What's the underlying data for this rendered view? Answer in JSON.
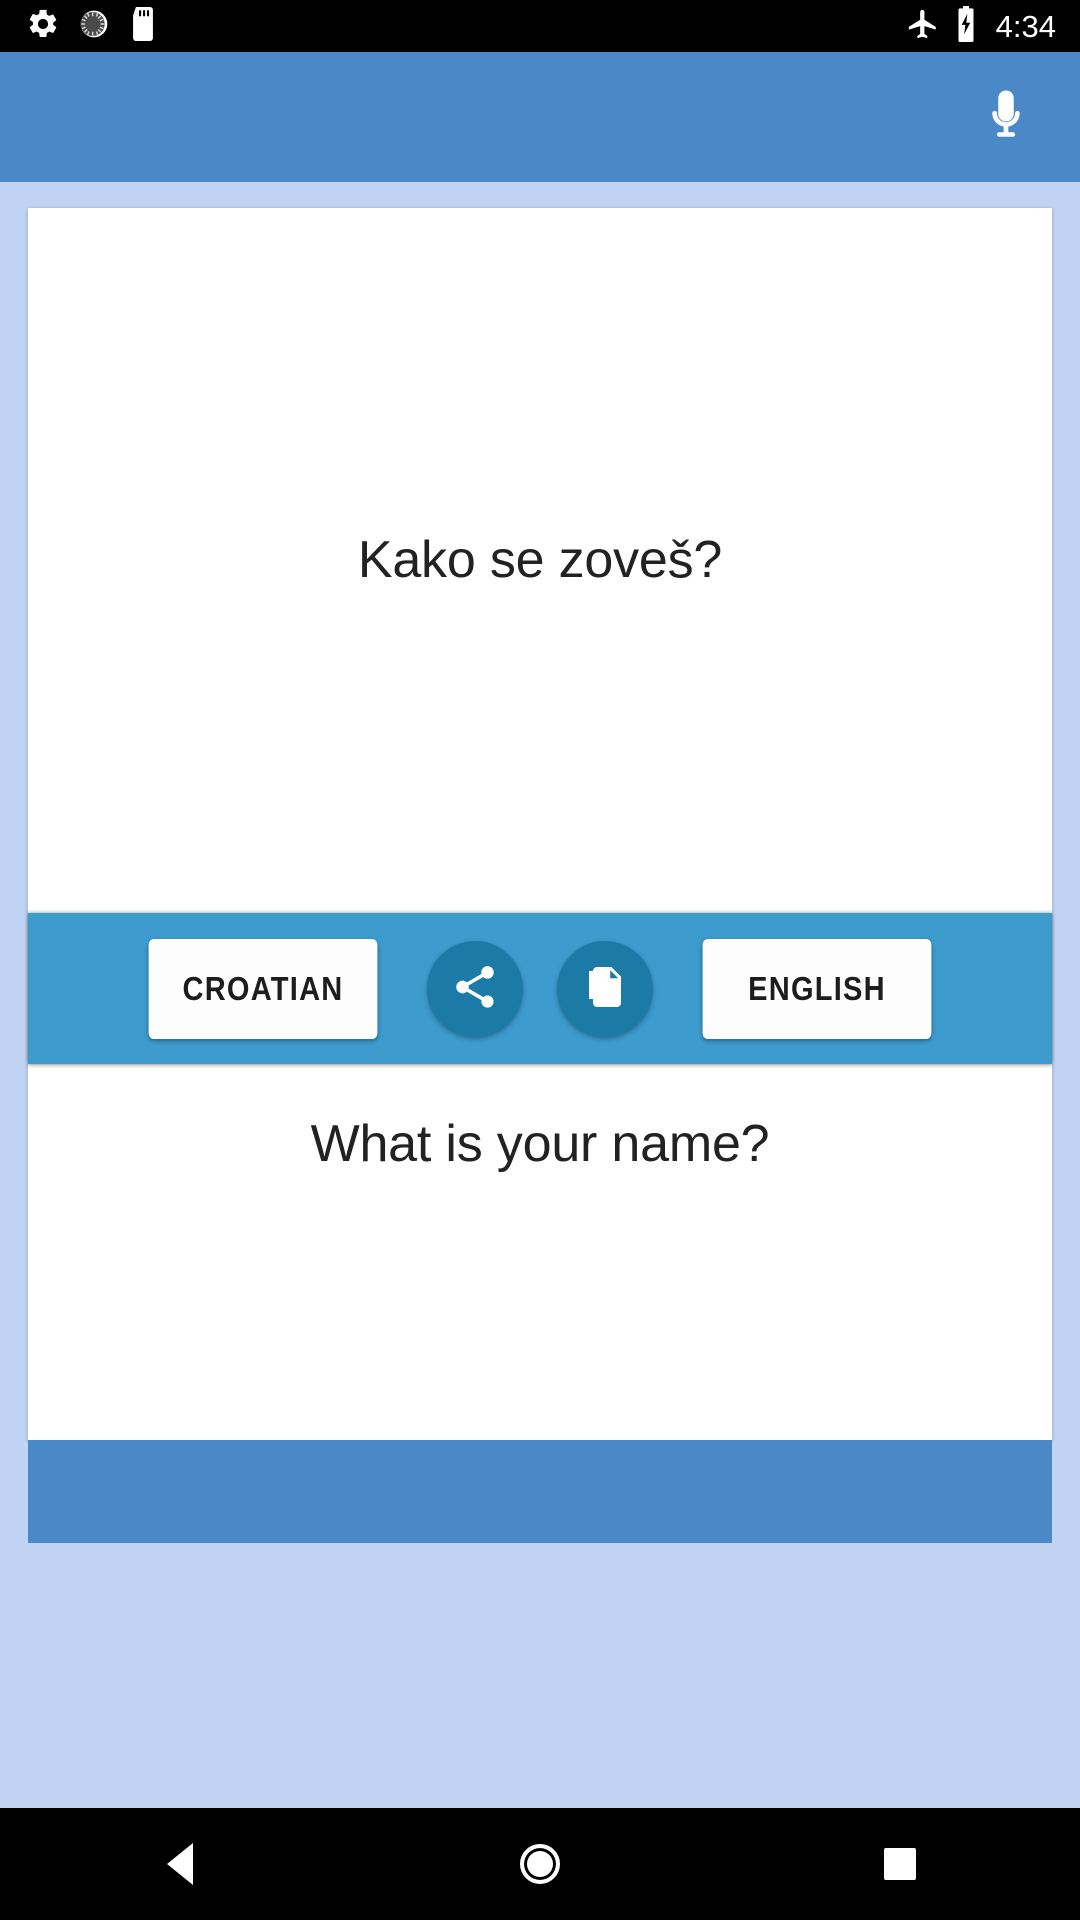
{
  "status_bar": {
    "icons_left": [
      "settings-gear-icon",
      "brightness-dial-icon",
      "sd-card-icon"
    ],
    "icons_right": [
      "airplane-mode-icon",
      "battery-charging-icon"
    ],
    "time": "4:34"
  },
  "app_bar": {
    "title": "",
    "mic_icon": "microphone-icon",
    "background_color": "#4a88c7"
  },
  "translation": {
    "source_text": "Kako se zoveš?",
    "target_text": "What is your name?"
  },
  "language_bar": {
    "source_language": "CROATIAN",
    "target_language": "ENGLISH",
    "share_icon": "share-icon",
    "copy_icon": "copy-icon",
    "background_color": "#3d9bce",
    "round_button_color": "#1b7ba6"
  },
  "nav_bar": {
    "back_label": "back-icon",
    "home_label": "home-icon",
    "recents_label": "recents-icon"
  }
}
